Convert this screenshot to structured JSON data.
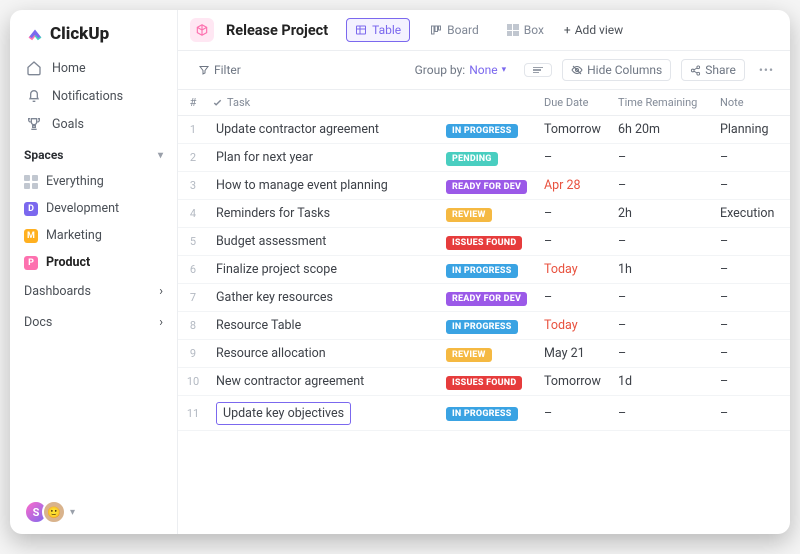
{
  "brand": "ClickUp",
  "nav": {
    "home": "Home",
    "notifications": "Notifications",
    "goals": "Goals"
  },
  "spaces": {
    "header": "Spaces",
    "everything": "Everything",
    "items": [
      {
        "badge": "D",
        "label": "Development"
      },
      {
        "badge": "M",
        "label": "Marketing"
      },
      {
        "badge": "P",
        "label": "Product"
      }
    ]
  },
  "dashboards": "Dashboards",
  "docs": "Docs",
  "project": {
    "title": "Release Project",
    "views": {
      "table": "Table",
      "board": "Board",
      "box": "Box"
    },
    "add_view": "Add view"
  },
  "toolbar": {
    "filter": "Filter",
    "group_by": "Group by:",
    "group_value": "None",
    "hide_columns": "Hide Columns",
    "share": "Share"
  },
  "columns": {
    "num": "#",
    "task": "Task",
    "due": "Due Date",
    "time": "Time Remaining",
    "note": "Note"
  },
  "rows": [
    {
      "n": "1",
      "task": "Update contractor agreement",
      "status": "IN PROGRESS",
      "statusClass": "s-inprogress",
      "due": "Tomorrow",
      "dueClass": "",
      "time": "6h 20m",
      "note": "Planning",
      "editing": false
    },
    {
      "n": "2",
      "task": "Plan for next year",
      "status": "PENDING",
      "statusClass": "s-pending",
      "due": "–",
      "dueClass": "",
      "time": "–",
      "note": "–",
      "editing": false
    },
    {
      "n": "3",
      "task": "How to manage event planning",
      "status": "READY FOR DEV",
      "statusClass": "s-readyfordev",
      "due": "Apr 28",
      "dueClass": "due-red",
      "time": "–",
      "note": "–",
      "editing": false
    },
    {
      "n": "4",
      "task": "Reminders for Tasks",
      "status": "REVIEW",
      "statusClass": "s-review",
      "due": "–",
      "dueClass": "",
      "time": "2h",
      "note": "Execution",
      "editing": false
    },
    {
      "n": "5",
      "task": "Budget assessment",
      "status": "ISSUES FOUND",
      "statusClass": "s-issuesfound",
      "due": "–",
      "dueClass": "",
      "time": "–",
      "note": "–",
      "editing": false
    },
    {
      "n": "6",
      "task": "Finalize project scope",
      "status": "IN PROGRESS",
      "statusClass": "s-inprogress",
      "due": "Today",
      "dueClass": "due-red",
      "time": "1h",
      "note": "–",
      "editing": false
    },
    {
      "n": "7",
      "task": "Gather key resources",
      "status": "READY FOR DEV",
      "statusClass": "s-readyfordev",
      "due": "–",
      "dueClass": "",
      "time": "–",
      "note": "–",
      "editing": false
    },
    {
      "n": "8",
      "task": "Resource Table",
      "status": "IN PROGRESS",
      "statusClass": "s-inprogress",
      "due": "Today",
      "dueClass": "due-red",
      "time": "–",
      "note": "–",
      "editing": false
    },
    {
      "n": "9",
      "task": "Resource allocation",
      "status": "REVIEW",
      "statusClass": "s-review",
      "due": "May 21",
      "dueClass": "",
      "time": "–",
      "note": "–",
      "editing": false
    },
    {
      "n": "10",
      "task": "New contractor agreement",
      "status": "ISSUES FOUND",
      "statusClass": "s-issuesfound",
      "due": "Tomorrow",
      "dueClass": "",
      "time": "1d",
      "note": "–",
      "editing": false
    },
    {
      "n": "11",
      "task": "Update key objectives",
      "status": "IN PROGRESS",
      "statusClass": "s-inprogress",
      "due": "–",
      "dueClass": "",
      "time": "–",
      "note": "–",
      "editing": true
    }
  ]
}
